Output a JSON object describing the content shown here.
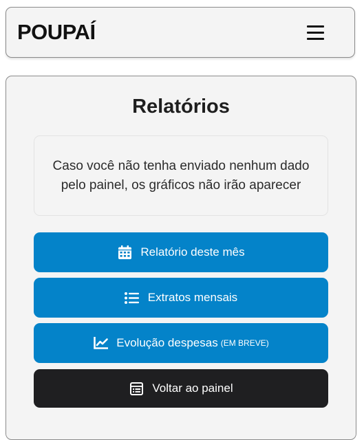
{
  "header": {
    "brand": "POUPAÍ",
    "menu_icon": "hamburger-menu-icon"
  },
  "main": {
    "title": "Relatórios",
    "notice": "Caso você não tenha enviado nenhum dado pelo painel, os gráficos não irão aparecer",
    "buttons": [
      {
        "label": "Relatório deste mês",
        "icon": "calendar-icon",
        "color": "#0483c9"
      },
      {
        "label": "Extratos mensais",
        "icon": "list-icon",
        "color": "#0483c9"
      },
      {
        "label": "Evolução despesas",
        "tag": "(EM BREVE)",
        "icon": "line-chart-icon",
        "color": "#0483c9"
      },
      {
        "label": "Voltar ao painel",
        "icon": "panel-icon",
        "color": "#1f1f21"
      }
    ]
  }
}
